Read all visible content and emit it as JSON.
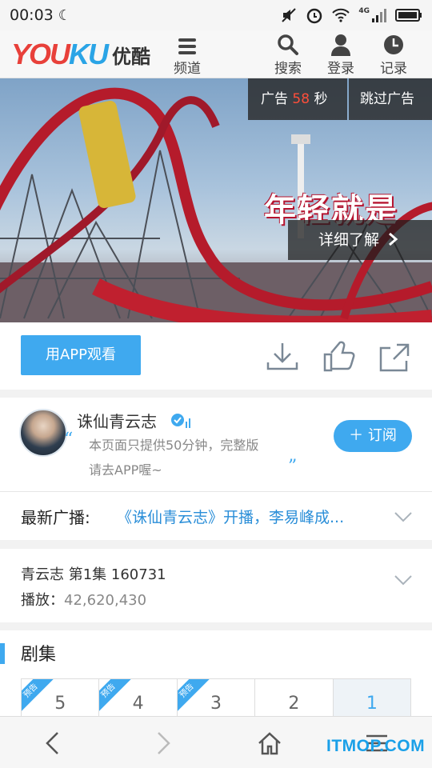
{
  "status_bar": {
    "time": "00:03",
    "network": "4G"
  },
  "header": {
    "logo_en": "YOUKU",
    "logo_cn": "优酷",
    "items": [
      {
        "label": "频道",
        "icon": "menu-icon"
      },
      {
        "label": "搜索",
        "icon": "search-icon"
      },
      {
        "label": "登录",
        "icon": "user-icon"
      },
      {
        "label": "记录",
        "icon": "history-icon"
      }
    ]
  },
  "video": {
    "ad_prefix": "广告",
    "ad_seconds": "58",
    "ad_suffix": "秒",
    "skip_label": "跳过广告",
    "detail_label": "详细了解",
    "slogan": "年轻就是"
  },
  "actions": {
    "app_button": "用APP观看",
    "icons": [
      "download-icon",
      "like-icon",
      "share-icon"
    ]
  },
  "channel": {
    "name": "诛仙青云志",
    "desc_line1": "本页面只提供50分钟，完整版",
    "desc_line2": "请去APP喔~",
    "subscribe_label": "＋ 订阅"
  },
  "news": {
    "label": "最新广播:",
    "text": "《诛仙青云志》开播，李易峰成..."
  },
  "episode_info": {
    "title": "青云志 第1集 160731",
    "plays_label": "播放：",
    "plays_value": "42,620,430"
  },
  "episodes": {
    "heading": "剧集",
    "items": [
      {
        "num": "5",
        "tag": "预告"
      },
      {
        "num": "4",
        "tag": "预告"
      },
      {
        "num": "3",
        "tag": "预告"
      },
      {
        "num": "2",
        "tag": ""
      },
      {
        "num": "1",
        "tag": "",
        "active": true
      }
    ]
  },
  "watermark": "ITMOP.COM",
  "colors": {
    "accent": "#3fa9ef",
    "ad_number": "#ff4e3a",
    "news_link": "#2a8ed8"
  }
}
